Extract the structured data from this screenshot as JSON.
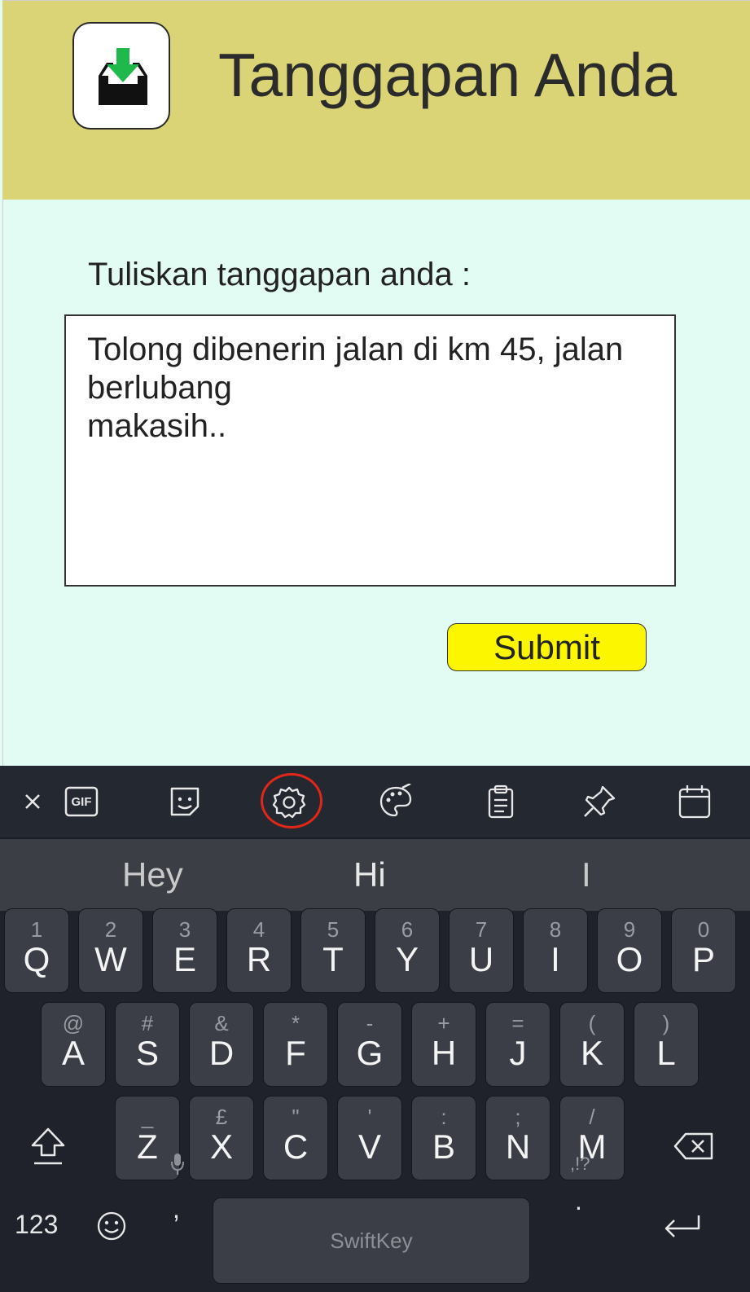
{
  "header": {
    "title": "Tanggapan Anda",
    "icon": "inbox-download-icon",
    "background": "#dbd477"
  },
  "form": {
    "prompt": "Tuliskan tanggapan anda :",
    "response_text": "Tolong dibenerin jalan di km 45, jalan berlubang\nmakasih..",
    "submit_label": "Submit",
    "submit_color": "#fcf600"
  },
  "keyboard": {
    "toolbar_icons": [
      "close-icon",
      "gif-icon",
      "sticker-icon",
      "settings-icon",
      "theme-palette-icon",
      "clipboard-icon",
      "pin-icon",
      "calendar-icon"
    ],
    "gif_label": "GIF",
    "suggestions": [
      "Hey",
      "Hi",
      "I"
    ],
    "row1": [
      {
        "hint": "1",
        "key": "Q"
      },
      {
        "hint": "2",
        "key": "W"
      },
      {
        "hint": "3",
        "key": "E"
      },
      {
        "hint": "4",
        "key": "R"
      },
      {
        "hint": "5",
        "key": "T"
      },
      {
        "hint": "6",
        "key": "Y"
      },
      {
        "hint": "7",
        "key": "U"
      },
      {
        "hint": "8",
        "key": "I"
      },
      {
        "hint": "9",
        "key": "O"
      },
      {
        "hint": "0",
        "key": "P"
      }
    ],
    "row2": [
      {
        "hint": "@",
        "key": "A"
      },
      {
        "hint": "#",
        "key": "S"
      },
      {
        "hint": "&",
        "key": "D"
      },
      {
        "hint": "*",
        "key": "F"
      },
      {
        "hint": "-",
        "key": "G"
      },
      {
        "hint": "+",
        "key": "H"
      },
      {
        "hint": "=",
        "key": "J"
      },
      {
        "hint": "(",
        "key": "K"
      },
      {
        "hint": ")",
        "key": "L"
      }
    ],
    "row3": [
      {
        "hint": "_",
        "key": "Z"
      },
      {
        "hint": "£",
        "key": "X"
      },
      {
        "hint": "\"",
        "key": "C"
      },
      {
        "hint": "'",
        "key": "V"
      },
      {
        "hint": ":",
        "key": "B"
      },
      {
        "hint": ";",
        "key": "N"
      },
      {
        "hint": "/",
        "key": "M"
      }
    ],
    "numbers_label": "123",
    "comma_label": ",",
    "space_label": "SwiftKey",
    "period_hint": ",!?",
    "period_label": ".",
    "accent": "#e0271a"
  }
}
